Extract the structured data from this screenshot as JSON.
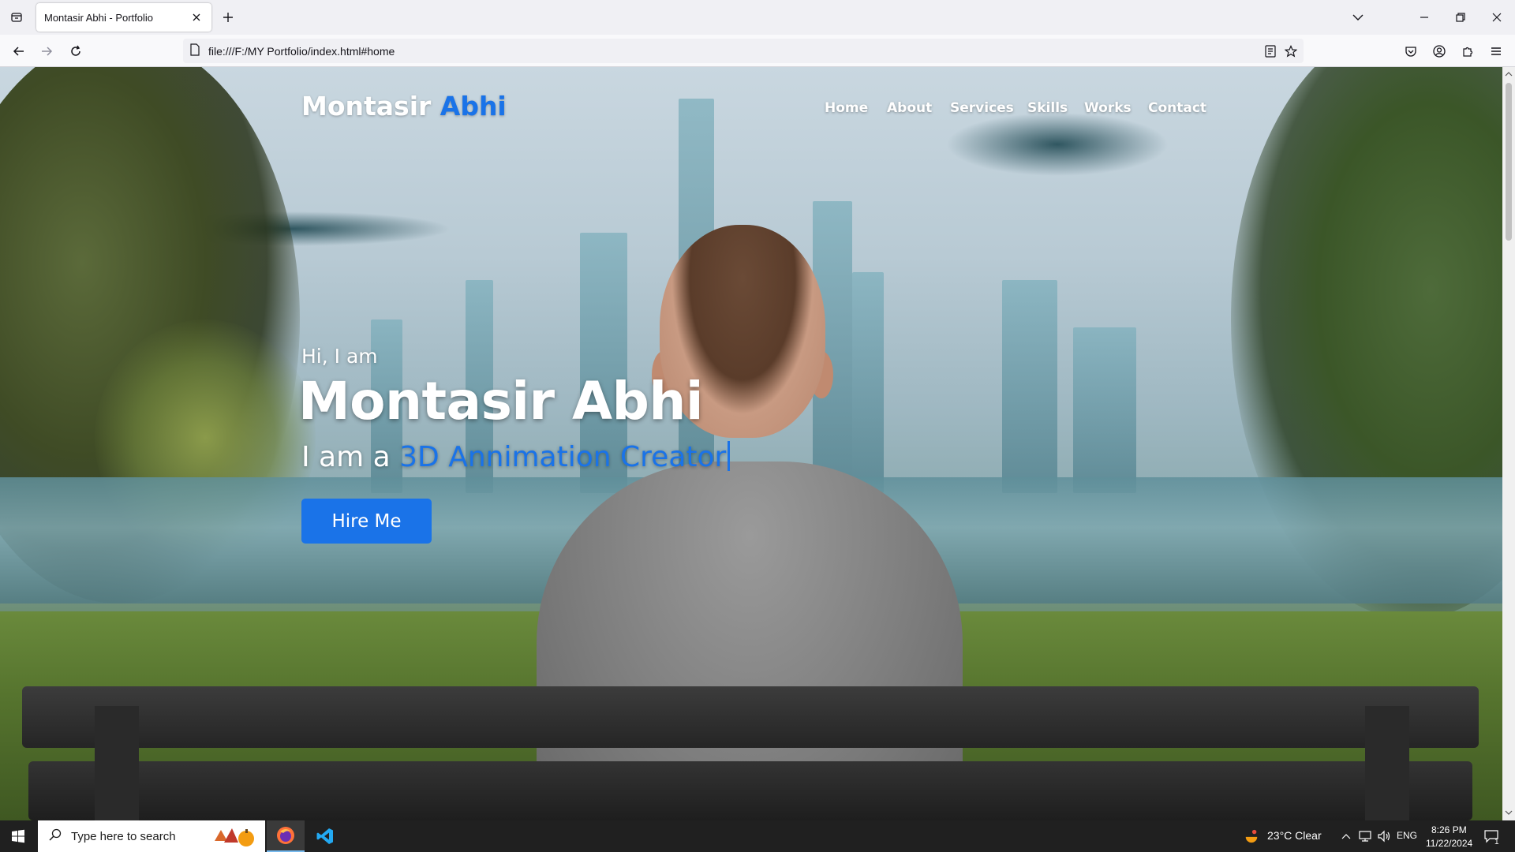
{
  "browser": {
    "tab_title": "Montasir Abhi - Portfolio",
    "url": "file:///F:/MY Portfolio/index.html#home"
  },
  "site": {
    "brand_first": "Montasir",
    "brand_accent": "Abhi",
    "nav": [
      "Home",
      "About",
      "Services",
      "Skills",
      "Works",
      "Contact"
    ],
    "hero": {
      "greeting": "Hi, I am",
      "name": "Montasir Abhi",
      "role_prefix": "I am a",
      "role": "3D Annimation Creator",
      "cta": "Hire Me"
    },
    "accent_color": "#1a73e8"
  },
  "taskbar": {
    "search_placeholder": "Type here to search",
    "weather": "23°C  Clear",
    "language": "ENG",
    "time": "8:26 PM",
    "date": "11/22/2024",
    "notification_count": "1"
  }
}
